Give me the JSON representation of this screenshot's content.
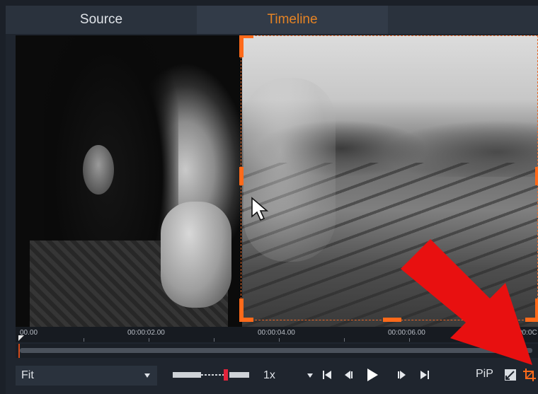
{
  "tabs": [
    {
      "label": "Source",
      "active": false
    },
    {
      "label": "Timeline",
      "active": true
    }
  ],
  "timeline": {
    "tick_labels": [
      "00.00",
      "00:00:02.00",
      "00:00:04.00",
      "00:00:06.00",
      "00:0C"
    ]
  },
  "controls": {
    "fit_label": "Fit",
    "speed_label": "1x",
    "pip_label": "PiP"
  },
  "colors": {
    "accent": "#e58324",
    "crop_frame": "#ff6a1a",
    "annotation_arrow": "#e81010"
  },
  "icons": {
    "shuttle": "shuttle-slider-icon",
    "go_start": "skip-to-start-icon",
    "step_back": "step-back-icon",
    "play": "play-icon",
    "step_forward": "step-forward-icon",
    "go_end": "skip-to-end-icon",
    "fullscreen": "fullscreen-icon",
    "crop": "crop-icon",
    "annotation": "red-arrow-annotation"
  }
}
